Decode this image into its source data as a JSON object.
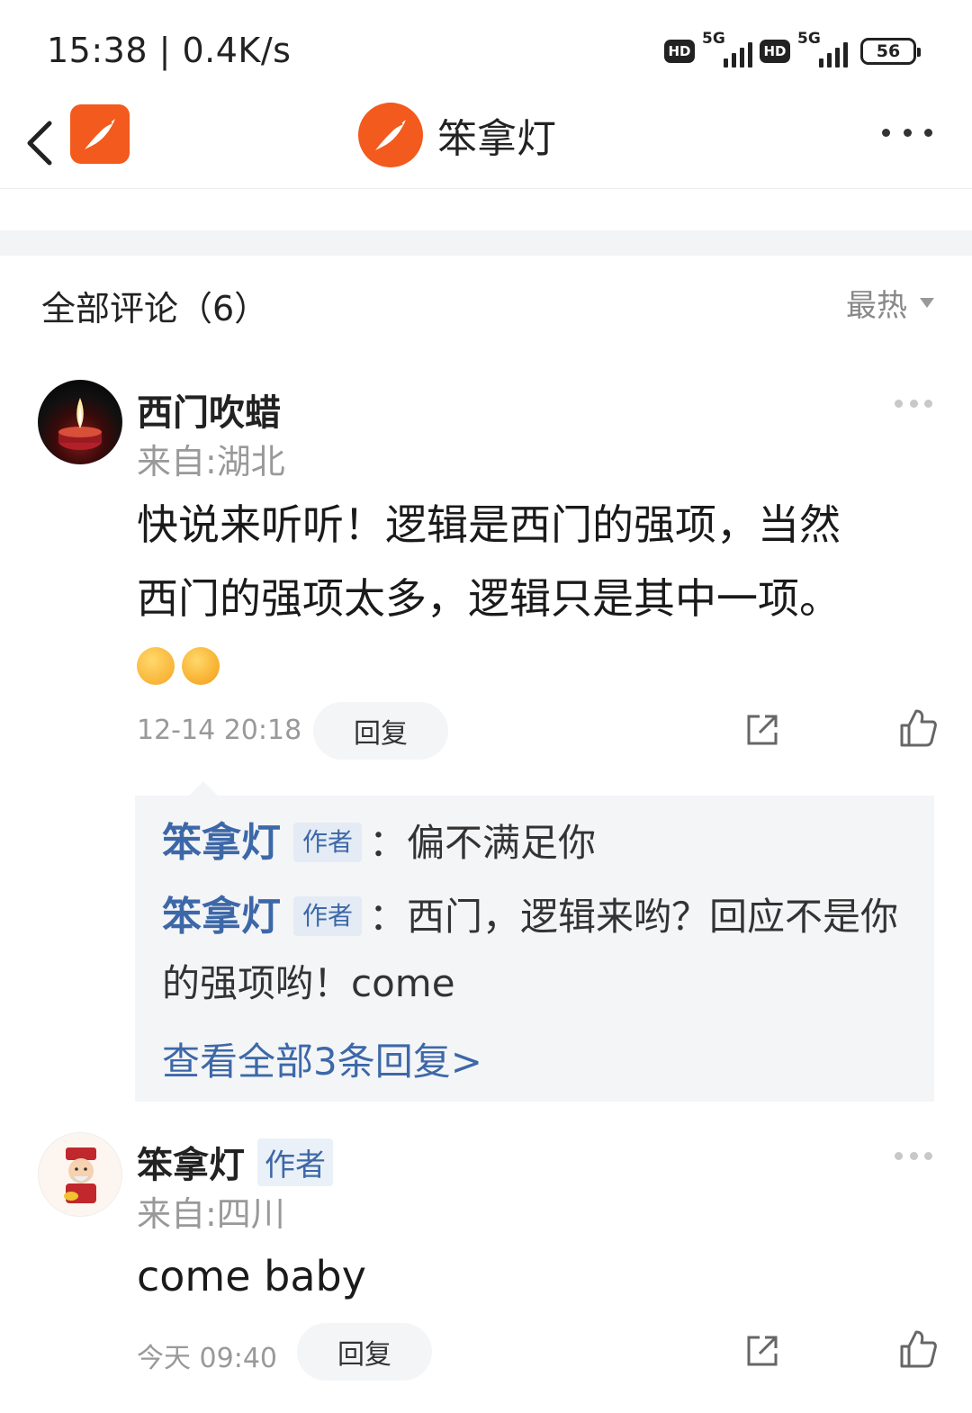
{
  "status_bar": {
    "time": "15:38 | 0.4K/s",
    "hd": "HD",
    "network": "5G",
    "battery": "56"
  },
  "nav": {
    "title": "笨拿灯",
    "brand_color": "#f35a1d"
  },
  "comments_header": {
    "title": "全部评论（6）",
    "sort": "最热"
  },
  "comments": [
    {
      "username": "西门吹蜡",
      "location": "来自:湖北",
      "content_line1": "快说来听听！逻辑是西门的强项，当然",
      "content_line2": "西门的强项太多，逻辑只是其中一项。",
      "time": "12-14 20:18",
      "reply_label": "回复",
      "replies": [
        {
          "author": "笨拿灯",
          "tag": "作者",
          "text": "：偏不满足你"
        },
        {
          "author": "笨拿灯",
          "tag": "作者",
          "text": "：西门，逻辑来哟？回应不是你",
          "text_cont": "的强项哟！come"
        }
      ],
      "view_all": "查看全部3条回复>"
    },
    {
      "username": "笨拿灯",
      "tag": "作者",
      "location": "来自:四川",
      "content": "come baby",
      "time": "今天 09:40",
      "reply_label": "回复"
    }
  ]
}
